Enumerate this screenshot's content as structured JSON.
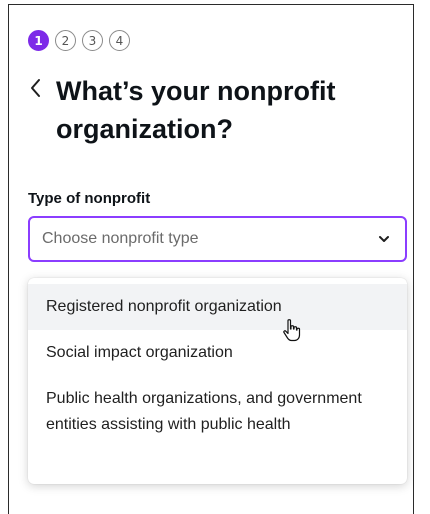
{
  "steps": [
    "1",
    "2",
    "3",
    "4"
  ],
  "active_step": "1",
  "header": {
    "back_icon": "chevron-left-icon",
    "title": "What’s your nonprofit organization?"
  },
  "field": {
    "label": "Type of nonprofit",
    "placeholder": "Choose nonprofit type",
    "chevron_icon": "chevron-down-icon"
  },
  "dropdown": {
    "options": [
      "Registered nonprofit organization",
      "Social impact organization",
      "Public health organizations, and government entities assisting with public health"
    ],
    "hovered_index": 0
  },
  "colors": {
    "accent": "#7d2ae8",
    "focus_border": "#8b3dff",
    "hover_bg": "#f2f3f5"
  }
}
